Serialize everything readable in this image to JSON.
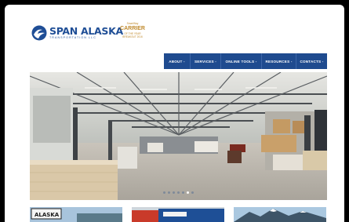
{
  "brand": {
    "name": "SPAN ALASKA",
    "subtitle": "TRANSPORTATION LLC",
    "primary_color": "#1f4e96"
  },
  "award": {
    "sponsor": "SmartWay",
    "title": "CARRIER",
    "line": "OF THE YEAR",
    "detail": "BREAKOUT 2016",
    "color": "#c08a2c"
  },
  "nav": {
    "items": [
      {
        "label": "ABOUT -"
      },
      {
        "label": "SERVICES -"
      },
      {
        "label": "ONLINE TOOLS -"
      },
      {
        "label": "RESOURCES -"
      },
      {
        "label": "CONTACTS -"
      }
    ]
  },
  "hero": {
    "slides": 7,
    "active_slide": 5
  },
  "thumbnails": [
    {
      "sign_text": "ALASKA"
    },
    {
      "sign_text": ""
    },
    {
      "sign_text": ""
    }
  ]
}
